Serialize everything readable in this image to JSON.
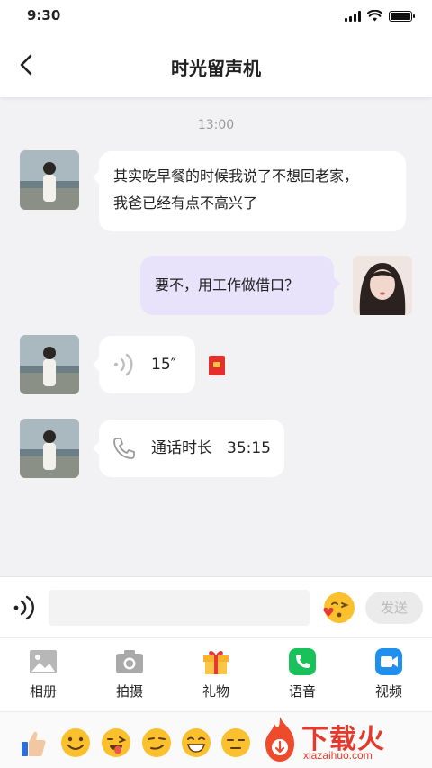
{
  "status_bar": {
    "time": "9:30"
  },
  "header": {
    "title": "时光留声机"
  },
  "chat": {
    "timestamp": "13:00",
    "messages": [
      {
        "type": "text",
        "from": "other",
        "lines": [
          "其实吃早餐的时候我说了不想回老家，",
          "我爸已经有点不高兴了"
        ]
      },
      {
        "type": "text",
        "from": "me",
        "lines": [
          "要不，用工作做借口？"
        ]
      },
      {
        "type": "voice",
        "from": "other",
        "duration": "15″"
      },
      {
        "type": "call",
        "from": "other",
        "label": "通话时长",
        "duration": "35:15"
      }
    ]
  },
  "input": {
    "placeholder": "",
    "value": "",
    "send_label": "发送"
  },
  "toolbar": [
    {
      "label": "相册",
      "icon": "image-icon",
      "color": "#9a9a9a"
    },
    {
      "label": "拍摄",
      "icon": "camera-icon",
      "color": "#9a9a9a"
    },
    {
      "label": "礼物",
      "icon": "gift-icon",
      "color": "#f5b022"
    },
    {
      "label": "语音",
      "icon": "phone-icon",
      "color": "#19c15a"
    },
    {
      "label": "视频",
      "icon": "video-icon",
      "color": "#1f8ff0"
    }
  ],
  "emoji_bar": {
    "icons": [
      "thumbs-up-icon",
      "smile-emoji",
      "tongue-emoji",
      "smirk-emoji",
      "grin-emoji",
      "expressionless-emoji"
    ]
  },
  "watermark": {
    "text": "下载火",
    "sub": "xiazaihuo.com"
  },
  "colors": {
    "my_bubble": "#e8e2fb",
    "other_bubble": "#ffffff",
    "send_disabled": "#ebebeb"
  }
}
